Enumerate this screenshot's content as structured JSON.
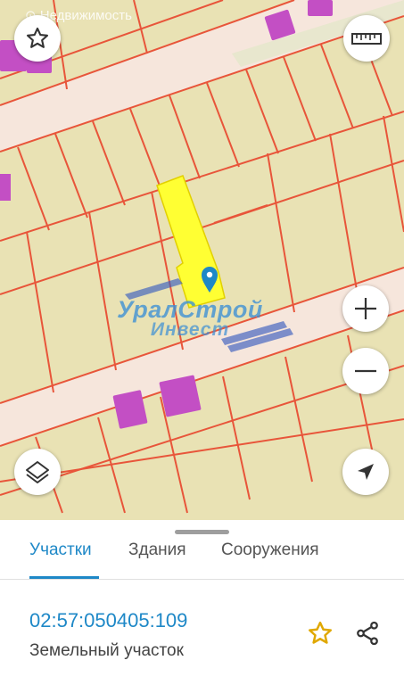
{
  "map": {
    "watermark_top": "Недвижимость",
    "watermark_logo_line1": "УралСтрой",
    "watermark_logo_line2": "Инвест",
    "colors": {
      "land": "#e9e2b4",
      "road": "#f6e6dc",
      "parcel_border": "#e8553a",
      "building": "#c34fc4",
      "selected": "#ffff33",
      "marker": "#1e88c7"
    },
    "buttons": {
      "favorite": "star-icon",
      "ruler": "ruler-icon",
      "zoom_in": "plus-icon",
      "zoom_out": "minus-icon",
      "layers": "layers-icon",
      "locate": "navigation-arrow-icon"
    }
  },
  "tabs": [
    {
      "label": "Участки",
      "active": true
    },
    {
      "label": "Здания",
      "active": false
    },
    {
      "label": "Сооружения",
      "active": false
    }
  ],
  "result": {
    "cadastral_number": "02:57:050405:109",
    "type": "Земельный участок"
  }
}
